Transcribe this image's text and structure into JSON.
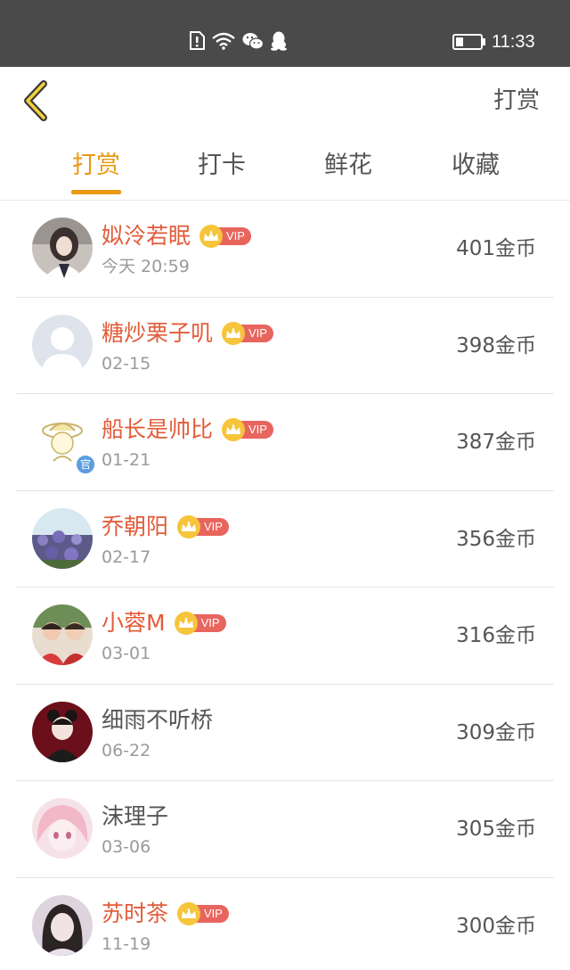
{
  "status_bar": {
    "icons": [
      "sim-alert-icon",
      "wifi-icon",
      "wechat-icon",
      "qq-penguin-icon",
      "battery-icon"
    ],
    "time": "11:33"
  },
  "header": {
    "title": "打赏",
    "back_icon": "chevron-left-icon"
  },
  "tabs": [
    {
      "label": "打赏",
      "active": true
    },
    {
      "label": "打卡",
      "active": false
    },
    {
      "label": "鲜花",
      "active": false
    },
    {
      "label": "收藏",
      "active": false
    }
  ],
  "vip_label": "VIP",
  "official_label": "官",
  "colors": {
    "accent": "#e89a13",
    "vip_name": "#e25c3a",
    "vip_badge": "#e8655e",
    "crown": "#f6c53b",
    "status_bar": "#4a4a4a"
  },
  "list": [
    {
      "name": "姒泠若眠",
      "date": "今天 20:59",
      "amount": "401金币",
      "vip": true
    },
    {
      "name": "糖炒栗子叽",
      "date": "02-15",
      "amount": "398金币",
      "vip": true
    },
    {
      "name": "船长是帅比",
      "date": "01-21",
      "amount": "387金币",
      "vip": true,
      "official": true
    },
    {
      "name": "乔朝阳",
      "date": "02-17",
      "amount": "356金币",
      "vip": true
    },
    {
      "name": "小蓉M",
      "date": "03-01",
      "amount": "316金币",
      "vip": true
    },
    {
      "name": "细雨不听桥",
      "date": "06-22",
      "amount": "309金币",
      "vip": false
    },
    {
      "name": "沫理子",
      "date": "03-06",
      "amount": "305金币",
      "vip": false
    },
    {
      "name": "苏时茶",
      "date": "11-19",
      "amount": "300金币",
      "vip": true
    }
  ]
}
